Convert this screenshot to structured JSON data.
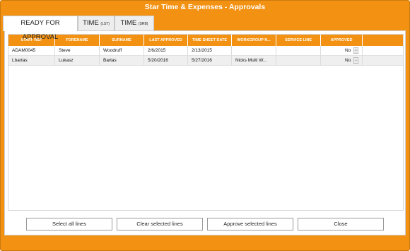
{
  "window": {
    "title": "Star Time & Expenses - Approvals"
  },
  "tabs": [
    {
      "label": "READY FOR APPROVAL",
      "sub": ""
    },
    {
      "label": "TIME",
      "sub": "(LST)"
    },
    {
      "label": "TIME",
      "sub": "(SRB)"
    }
  ],
  "table": {
    "headers": [
      "STAFF REF",
      "FORENAME",
      "SURNAME",
      "LAST APPROVED",
      "TIME SHEET DATE",
      "WORKGROUP N...",
      "SERVICE LINE",
      "APPROVED"
    ],
    "rows": [
      [
        "ADAM0045",
        "Steve",
        "Woodruff",
        "2/6/2015",
        "2/13/2015",
        "",
        "",
        "No"
      ],
      [
        "Lbartas",
        "Lukasz",
        "Bartas",
        "5/20/2016",
        "5/27/2016",
        "Nicks Multi W...",
        "",
        "No"
      ]
    ]
  },
  "icons": {
    "row_action": "document-icon"
  },
  "buttons": {
    "select_all": "Select all lines",
    "clear_selected": "Clear selected lines",
    "approve_selected": "Approve selected lines",
    "close": "Close"
  },
  "colors": {
    "accent": "#f39212",
    "header_text": "#ffffff"
  }
}
